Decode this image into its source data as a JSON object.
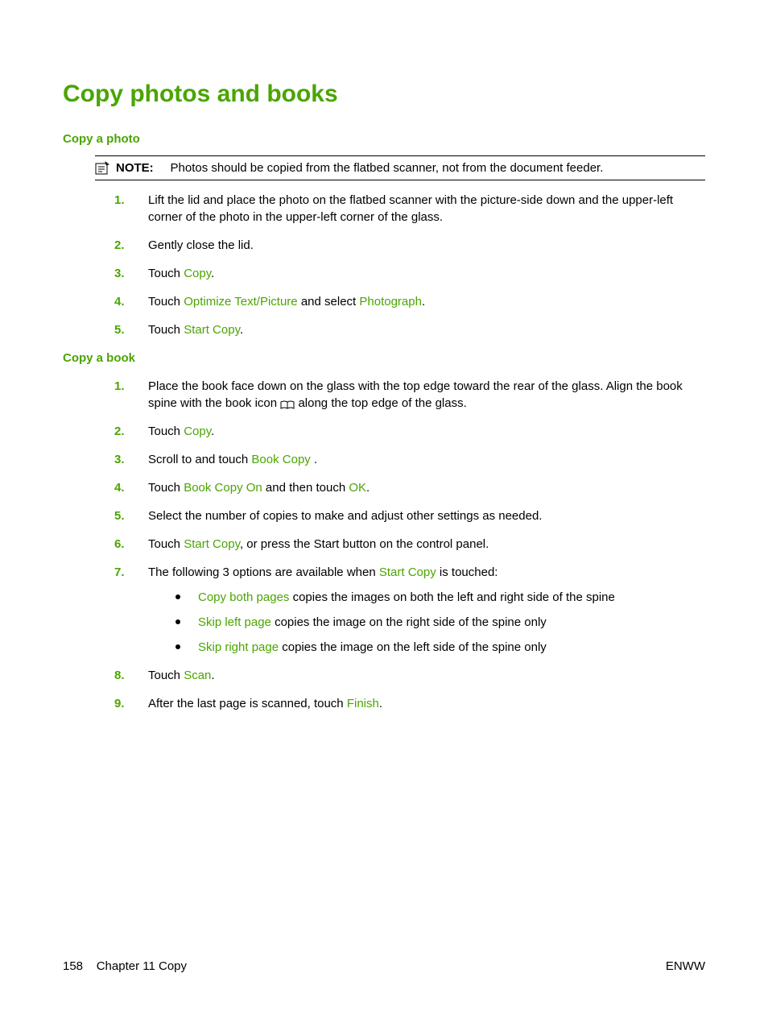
{
  "title": "Copy photos and books",
  "section1": {
    "heading": "Copy a photo",
    "note_label": "NOTE:",
    "note_text": "Photos should be copied from the flatbed scanner, not from the document feeder.",
    "steps": {
      "s1": "Lift the lid and place the photo on the flatbed scanner with the picture-side down and the upper-left corner of the photo in the upper-left corner of the glass.",
      "s2": "Gently close the lid.",
      "s3a": "Touch ",
      "s3_ui": "Copy",
      "s3b": ".",
      "s4a": "Touch ",
      "s4_ui1": "Optimize Text/Picture",
      "s4b": " and select ",
      "s4_ui2": "Photograph",
      "s4c": ".",
      "s5a": "Touch ",
      "s5_ui": "Start Copy",
      "s5b": "."
    }
  },
  "section2": {
    "heading": "Copy a book",
    "steps": {
      "s1a": "Place the book face down on the glass with the top edge toward the rear of the glass. Align the book spine with the book icon ",
      "s1b": " along the top edge of the glass.",
      "s2a": "Touch ",
      "s2_ui": "Copy",
      "s2b": ".",
      "s3a": "Scroll to and touch ",
      "s3_ui": "Book Copy",
      "s3b": " .",
      "s4a": "Touch ",
      "s4_ui1": "Book Copy On",
      "s4b": " and then touch ",
      "s4_ui2": "OK",
      "s4c": ".",
      "s5": "Select the number of copies to make and adjust other settings as needed.",
      "s6a": "Touch ",
      "s6_ui": "Start Copy",
      "s6b": ", or press the Start button on the control panel.",
      "s7a": "The following 3 options are available when ",
      "s7_ui": "Start Copy",
      "s7b": " is touched:",
      "b1_ui": "Copy both pages",
      "b1_txt": " copies the images on both the left and right side of the spine",
      "b2_ui": "Skip left page",
      "b2_txt": " copies the image on the right side of the spine only",
      "b3_ui": "Skip right page",
      "b3_txt": " copies the image on the left side of the spine only",
      "s8a": "Touch ",
      "s8_ui": "Scan",
      "s8b": ".",
      "s9a": "After the last page is scanned, touch ",
      "s9_ui": "Finish",
      "s9b": "."
    }
  },
  "footer": {
    "page_number": "158",
    "chapter": "Chapter 11   Copy",
    "right": "ENWW"
  }
}
